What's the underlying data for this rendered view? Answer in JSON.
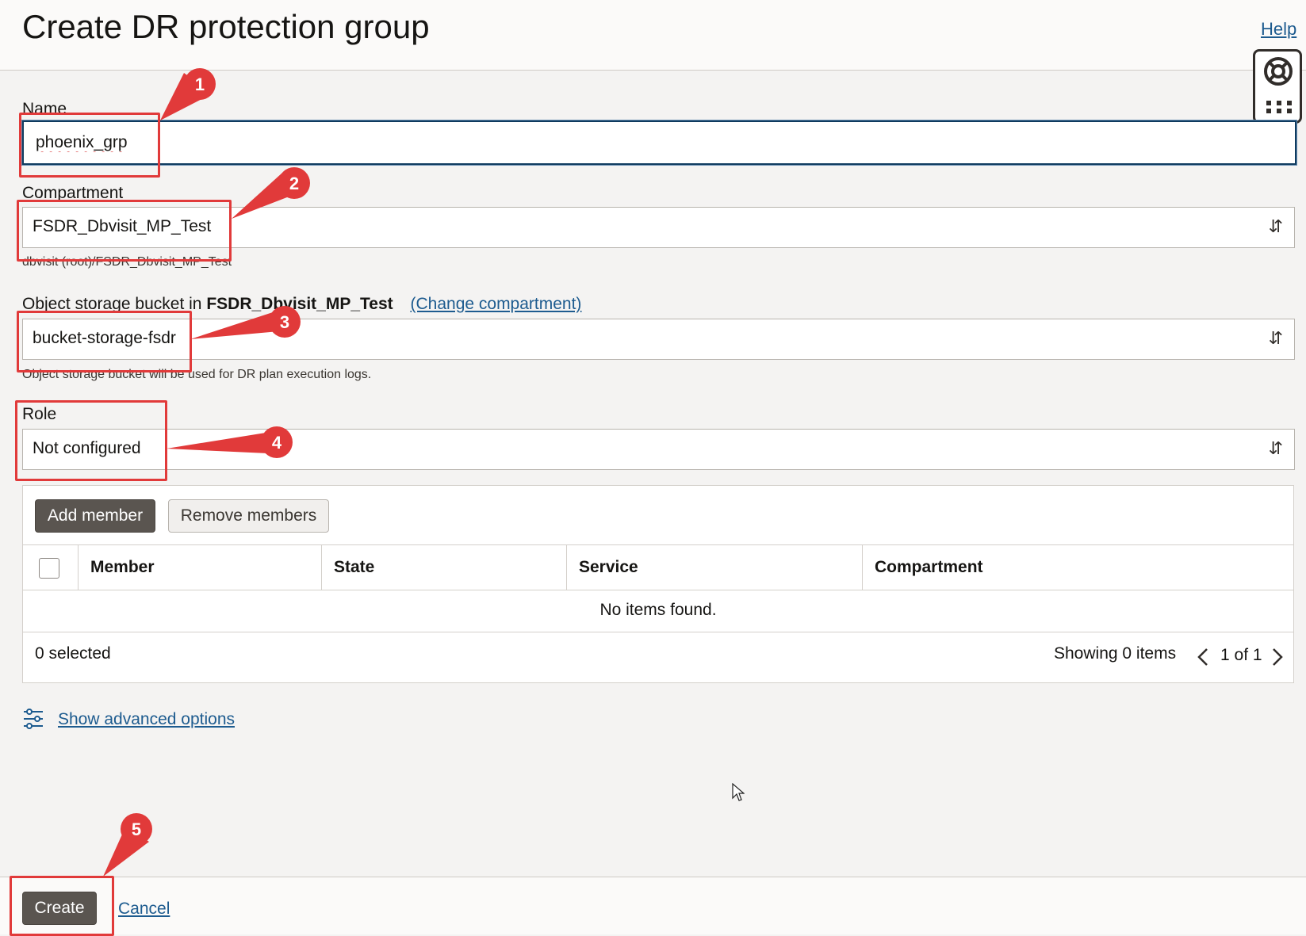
{
  "header": {
    "title": "Create DR protection group",
    "help_link": "Help"
  },
  "form": {
    "name_label": "Name",
    "name_value": "phoenix_grp",
    "compartment_label": "Compartment",
    "compartment_value": "FSDR_Dbvisit_MP_Test",
    "compartment_path": "dbvisit (root)/FSDR_Dbvisit_MP_Test",
    "bucket_label_prefix": "Object storage bucket in",
    "bucket_label_compartment": "FSDR_Dbvisit_MP_Test",
    "change_compartment_link": "(Change compartment)",
    "bucket_value": "bucket-storage-fsdr",
    "bucket_help": "Object storage bucket will be used for DR plan execution logs.",
    "role_label": "Role",
    "role_value": "Not configured"
  },
  "members_table": {
    "add_button": "Add member",
    "remove_button": "Remove members",
    "columns": [
      "Member",
      "State",
      "Service",
      "Compartment"
    ],
    "empty_message": "No items found.",
    "selected_count": "0 selected",
    "showing": "Showing 0 items",
    "pagination": "1 of 1"
  },
  "advanced_link": "Show advanced options",
  "footer": {
    "create_button": "Create",
    "cancel_link": "Cancel"
  },
  "annotations": [
    "1",
    "2",
    "3",
    "4",
    "5"
  ],
  "colors": {
    "annotation_red": "#e13a3a",
    "primary_button": "#5a5550",
    "link": "#1d5b8f"
  }
}
